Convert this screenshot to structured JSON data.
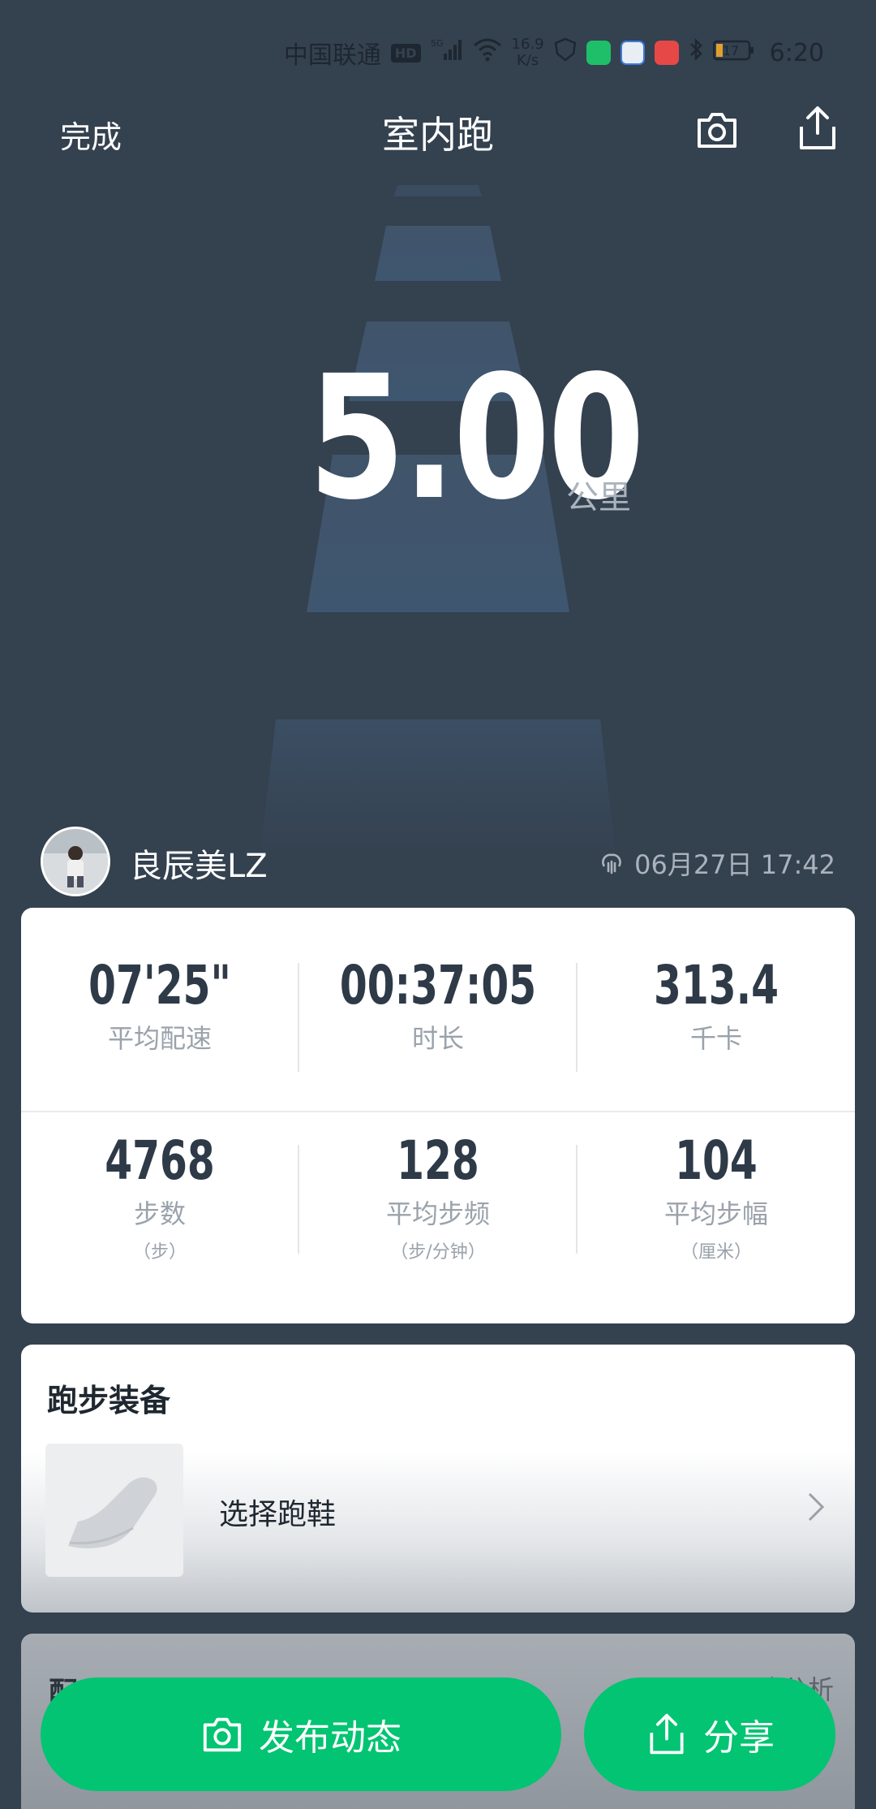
{
  "status_bar": {
    "carrier": "中国联通",
    "hd": "HD",
    "net_speed_value": "16.9",
    "net_speed_unit": "K/s",
    "battery": "17",
    "time": "6:20"
  },
  "nav": {
    "done_label": "完成",
    "title": "室内跑"
  },
  "run": {
    "distance": "5.00",
    "distance_unit": "公里"
  },
  "user": {
    "name": "良辰美LZ",
    "datetime": "06月27日 17:42"
  },
  "stats": [
    {
      "value": "07'25\"",
      "label": "平均配速",
      "unit": ""
    },
    {
      "value": "00:37:05",
      "label": "时长",
      "unit": ""
    },
    {
      "value": "313.4",
      "label": "千卡",
      "unit": ""
    },
    {
      "value": "4768",
      "label": "步数",
      "unit": "（步）"
    },
    {
      "value": "128",
      "label": "平均步频",
      "unit": "（步/分钟）"
    },
    {
      "value": "104",
      "label": "平均步幅",
      "unit": "（厘米）"
    }
  ],
  "gear": {
    "title": "跑步装备",
    "select_label": "选择跑鞋"
  },
  "next_card": {
    "title": "配",
    "link": "配速分析"
  },
  "actions": {
    "publish_label": "发布动态",
    "share_label": "分享"
  },
  "colors": {
    "background": "#34414f",
    "accent_green": "#02c472",
    "value_dark": "#2e3a47",
    "label_gray": "#9aa2ab"
  }
}
